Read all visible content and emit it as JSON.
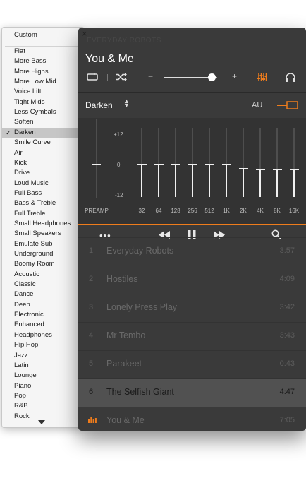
{
  "preset_menu": {
    "header": "Custom",
    "selected": "Darken",
    "items": [
      "Flat",
      "More Bass",
      "More Highs",
      "More Low Mid",
      "Voice Lift",
      "Tight Mids",
      "Less Cymbals",
      "Soften",
      "Darken",
      "Smile Curve",
      "Air",
      "Kick",
      "Drive",
      "Loud Music",
      "Full Bass",
      "Bass & Treble",
      "Full Treble",
      "Small Headphones",
      "Small Speakers",
      "Emulate Sub",
      "Underground",
      "Boomy Room",
      "Acoustic",
      "Classic",
      "Dance",
      "Deep",
      "Electronic",
      "Enhanced",
      "Headphones",
      "Hip Hop",
      "Jazz",
      "Latin",
      "Lounge",
      "Piano",
      "Pop",
      "R&B",
      "Rock"
    ],
    "scroll_icon": "chevron-down-icon"
  },
  "player": {
    "ghost_title": "EVERYDAY ROBOTS",
    "now_playing": "You & Me",
    "volume": {
      "minus_label": "−",
      "plus_label": "+",
      "level": 0.9
    },
    "eq_preset": "Darken",
    "au_label": "AU",
    "accent_color": "#ee7c1c",
    "eq": {
      "scale": {
        "top": "+12",
        "mid": "0",
        "bottom": "-12"
      },
      "preamp_label": "PREAMP",
      "preamp_db": 0,
      "bands": [
        {
          "label": "32",
          "db": 0
        },
        {
          "label": "64",
          "db": 0
        },
        {
          "label": "128",
          "db": 0
        },
        {
          "label": "256",
          "db": 0
        },
        {
          "label": "512",
          "db": 0
        },
        {
          "label": "1K",
          "db": 0
        },
        {
          "label": "2K",
          "db": -1.5
        },
        {
          "label": "4K",
          "db": -2
        },
        {
          "label": "8K",
          "db": -2
        },
        {
          "label": "16K",
          "db": -2
        }
      ]
    },
    "tracks": [
      {
        "num": "1",
        "title": "Everyday Robots",
        "time": "3:57"
      },
      {
        "num": "2",
        "title": "Hostiles",
        "time": "4:09"
      },
      {
        "num": "3",
        "title": "Lonely Press Play",
        "time": "3:42"
      },
      {
        "num": "4",
        "title": "Mr Tembo",
        "time": "3:43"
      },
      {
        "num": "5",
        "title": "Parakeet",
        "time": "0:43"
      },
      {
        "num": "6",
        "title": "The Selfish Giant",
        "time": "4:47"
      },
      {
        "num": "",
        "title": "You & Me",
        "time": "7:05"
      }
    ],
    "active_track_index": 5,
    "playing_track_index": 6
  }
}
